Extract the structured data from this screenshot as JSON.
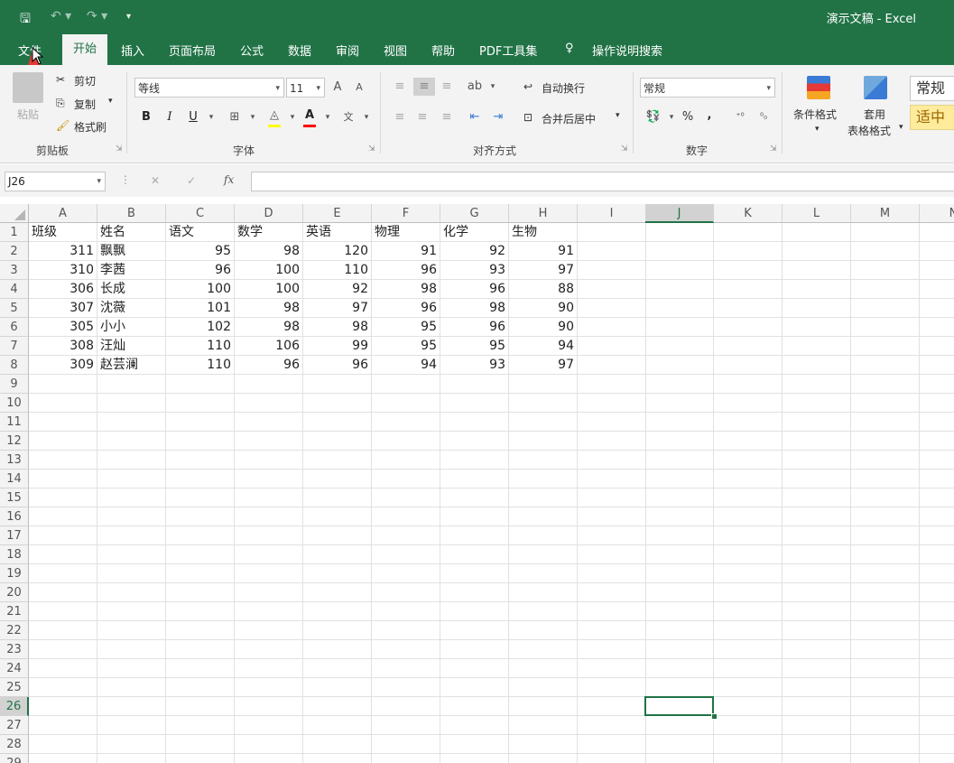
{
  "window": {
    "title": "演示文稿 - Excel",
    "quick_access": [
      "save-icon",
      "undo-icon",
      "redo-icon",
      "customize-icon"
    ]
  },
  "tabs": [
    {
      "label": "文件",
      "active": false
    },
    {
      "label": "开始",
      "active": true
    },
    {
      "label": "插入",
      "active": false
    },
    {
      "label": "页面布局",
      "active": false
    },
    {
      "label": "公式",
      "active": false
    },
    {
      "label": "数据",
      "active": false
    },
    {
      "label": "审阅",
      "active": false
    },
    {
      "label": "视图",
      "active": false
    },
    {
      "label": "帮助",
      "active": false
    },
    {
      "label": "PDF工具集",
      "active": false
    },
    {
      "label": "操作说明搜索",
      "active": false
    }
  ],
  "ribbon": {
    "clipboard": {
      "group_label": "剪贴板",
      "paste_label": "粘贴",
      "cut_label": "剪切",
      "copy_label": "复制",
      "format_painter_label": "格式刷"
    },
    "font": {
      "group_label": "字体",
      "font_name": "等线",
      "font_size": "11",
      "bold": "B",
      "italic": "I",
      "underline": "U",
      "grow": "A",
      "shrink": "A",
      "font_color": "A",
      "phonetic": "文",
      "fill_color_hex": "#ffff00",
      "font_color_hex": "#ff0000"
    },
    "alignment": {
      "group_label": "对齐方式",
      "wrap_label": "自动换行",
      "merge_label": "合并后居中"
    },
    "number": {
      "group_label": "数字",
      "format": "常规",
      "percent": "%",
      "comma": ","
    },
    "styles": {
      "conditional_label": "条件格式",
      "table_label_1": "套用",
      "table_label_2": "表格格式",
      "style_normal": "常规",
      "style_neutral": "适中"
    }
  },
  "formula_bar": {
    "name_box": "J26",
    "cancel": "✕",
    "enter": "✓",
    "fx": "fx",
    "value": ""
  },
  "sheet": {
    "columns": [
      "A",
      "B",
      "C",
      "D",
      "E",
      "F",
      "G",
      "H",
      "I",
      "J",
      "K",
      "L",
      "M",
      "N"
    ],
    "selected_column": "J",
    "selected_row": 26,
    "active_cell": "J26",
    "header_row": [
      "班级",
      "姓名",
      "语文",
      "数学",
      "英语",
      "物理",
      "化学",
      "生物"
    ],
    "rows": [
      [
        311,
        "飘飘",
        95,
        98,
        120,
        91,
        92,
        91
      ],
      [
        310,
        "李茜",
        96,
        100,
        110,
        96,
        93,
        97
      ],
      [
        306,
        "长成",
        100,
        100,
        92,
        98,
        96,
        88
      ],
      [
        307,
        "沈薇",
        101,
        98,
        97,
        96,
        98,
        90
      ],
      [
        305,
        "小小",
        102,
        98,
        98,
        95,
        96,
        90
      ],
      [
        308,
        "汪灿",
        110,
        106,
        99,
        95,
        95,
        94
      ],
      [
        309,
        "赵芸澜",
        110,
        96,
        96,
        94,
        93,
        97
      ]
    ],
    "row_numbers": [
      1,
      2,
      3,
      4,
      5,
      6,
      7,
      8,
      9,
      10,
      11,
      12,
      13,
      14,
      15,
      16,
      17,
      18,
      19,
      20,
      21,
      22,
      23,
      24,
      25,
      26,
      27,
      28,
      29
    ],
    "accent_color": "#217346"
  }
}
